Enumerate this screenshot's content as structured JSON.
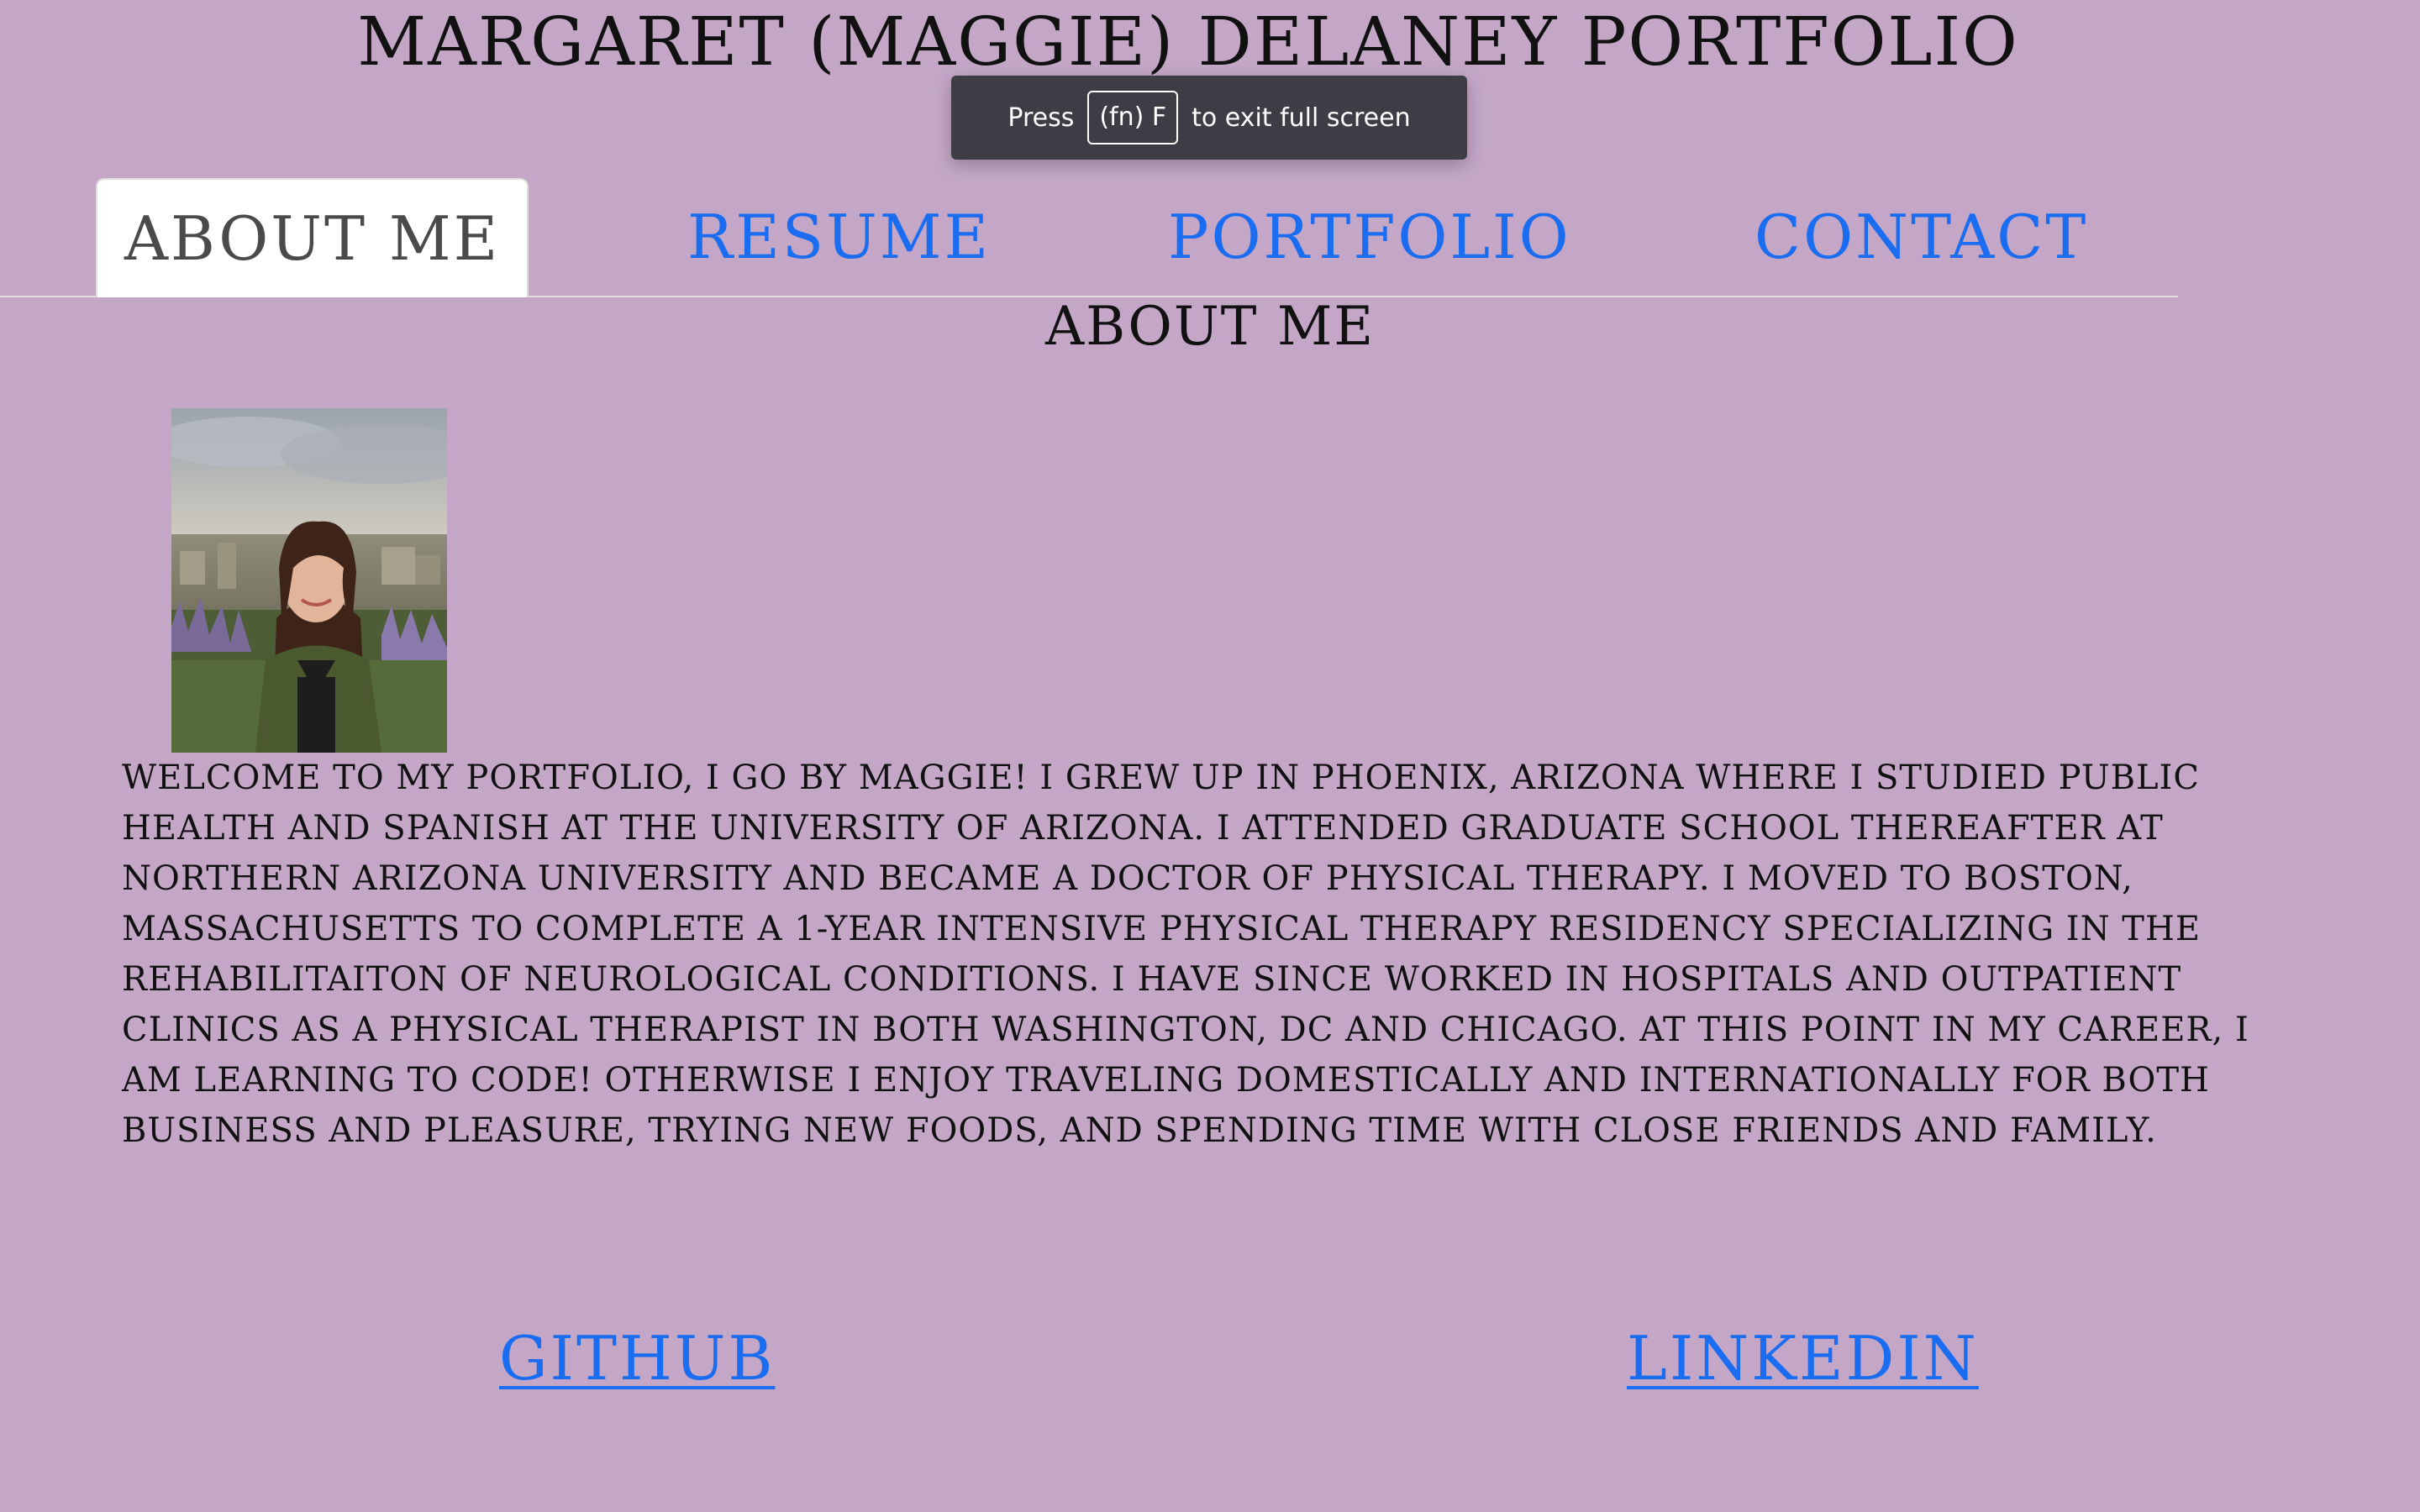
{
  "page": {
    "title": "MARGARET (MAGGIE) DELANEY PORTFOLIO"
  },
  "fullscreen_notice": {
    "prefix": "Press",
    "key": "(fn) F",
    "suffix": "to exit full screen"
  },
  "tabs": [
    {
      "label": "ABOUT ME",
      "active": true
    },
    {
      "label": "RESUME",
      "active": false
    },
    {
      "label": "PORTFOLIO",
      "active": false
    },
    {
      "label": "CONTACT",
      "active": false
    }
  ],
  "about": {
    "heading": "ABOUT ME",
    "bio": "WELCOME TO MY PORTFOLIO, I GO BY MAGGIE! I GREW UP IN PHOENIX, ARIZONA WHERE I STUDIED PUBLIC HEALTH AND SPANISH AT THE UNIVERSITY OF ARIZONA. I ATTENDED GRADUATE SCHOOL THEREAFTER AT NORTHERN ARIZONA UNIVERSITY AND BECAME A DOCTOR OF PHYSICAL THERAPY. I MOVED TO BOSTON, MASSACHUSETTS TO COMPLETE A 1-YEAR INTENSIVE PHYSICAL THERAPY RESIDENCY SPECIALIZING IN THE REHABILITAITON OF NEUROLOGICAL CONDITIONS. I HAVE SINCE WORKED IN HOSPITALS AND OUTPATIENT CLINICS AS A PHYSICAL THERAPIST IN BOTH WASHINGTON, DC AND CHICAGO. AT THIS POINT IN MY CAREER, I AM LEARNING TO CODE! OTHERWISE I ENJOY TRAVELING DOMESTICALLY AND INTERNATIONALLY FOR BOTH BUSINESS AND PLEASURE, TRYING NEW FOODS, AND SPENDING TIME WITH CLOSE FRIENDS AND FAMILY."
  },
  "footer_links": {
    "github": "GITHUB",
    "linkedin": "LINKEDIN"
  },
  "colors": {
    "background": "#c4a7c7",
    "link": "#1a6cf0",
    "active_tab_bg": "#ffffff",
    "toast_bg": "#3e3c45"
  }
}
